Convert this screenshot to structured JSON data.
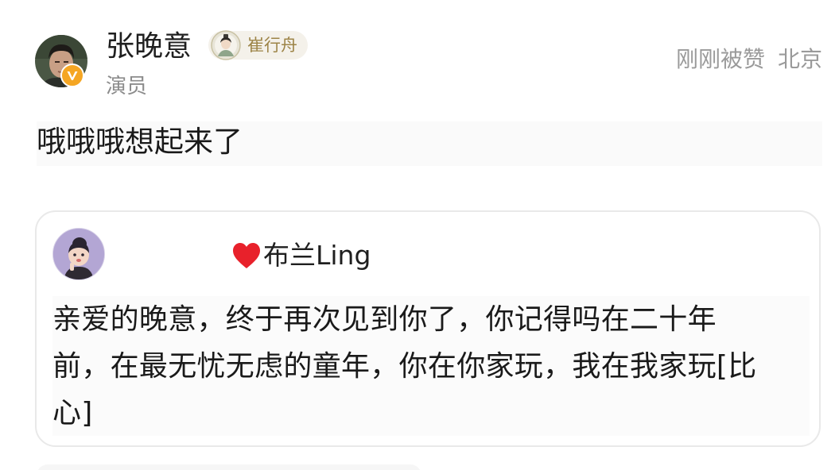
{
  "comment": {
    "author": {
      "name": "张晚意",
      "title": "演员",
      "fan_badge": "崔行舟",
      "avatar_icon": "user-avatar-icon",
      "verified_icon": "verified-v-badge-icon",
      "verified_color": "#f5a623"
    },
    "meta": {
      "time": "刚刚被赞",
      "location": "北京"
    },
    "text": "哦哦哦想起来了"
  },
  "quoted": {
    "author": {
      "name": "布兰Ling",
      "avatar_icon": "cartoon-avatar-icon",
      "heart_icon": "red-heart-icon",
      "heart_color": "#e8212b"
    },
    "lines": [
      "亲爱的晚意，终于再次见到你了，你记得吗在二十年",
      "前，在最无忧无虑的童年，你在你家玩，我在我家玩[比",
      "心]"
    ]
  },
  "colors": {
    "fan_badge_text": "#9d8447",
    "secondary_text": "#9a9a9a"
  }
}
